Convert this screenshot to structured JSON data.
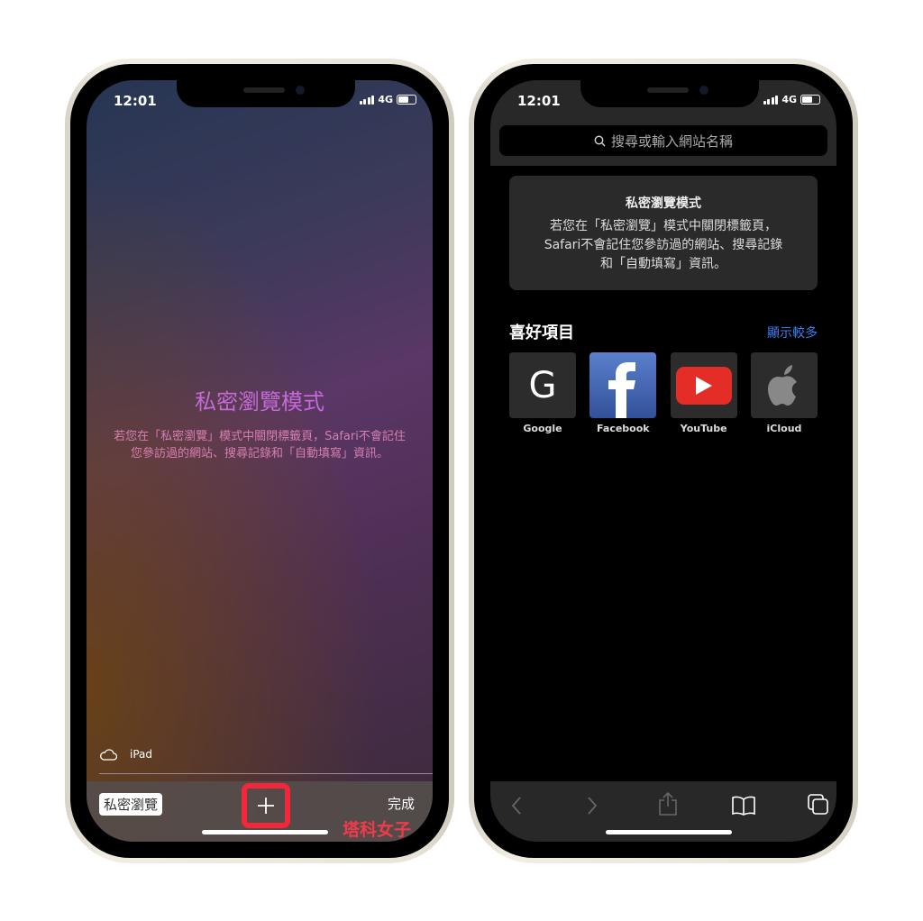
{
  "status": {
    "time": "12:01",
    "network": "4G"
  },
  "left": {
    "title": "私密瀏覽模式",
    "description": "若您在「私密瀏覽」模式中關閉標籤頁，Safari不會記住您參訪過的網站、搜尋記錄和「自動填寫」資訊。",
    "icloud_device": "iPad",
    "private_button": "私密瀏覽",
    "done_button": "完成"
  },
  "right": {
    "search_placeholder": "搜尋或輸入網站名稱",
    "card_title": "私密瀏覽模式",
    "card_lines": [
      "若您在「私密瀏覽」模式中關閉標籤頁，",
      "Safari不會記住您參訪過的網站、搜尋記錄",
      "和「自動填寫」資訊。"
    ],
    "favorites_title": "喜好項目",
    "show_more": "顯示較多",
    "favorites": [
      {
        "label": "Google",
        "icon": "google-icon"
      },
      {
        "label": "Facebook",
        "icon": "facebook-icon"
      },
      {
        "label": "YouTube",
        "icon": "youtube-icon"
      },
      {
        "label": "iCloud",
        "icon": "apple-icon"
      }
    ]
  },
  "watermark": "塔科女子",
  "colors": {
    "highlight": "#f3263a",
    "link": "#3a80f0",
    "title_purple": "#c46ad8"
  }
}
